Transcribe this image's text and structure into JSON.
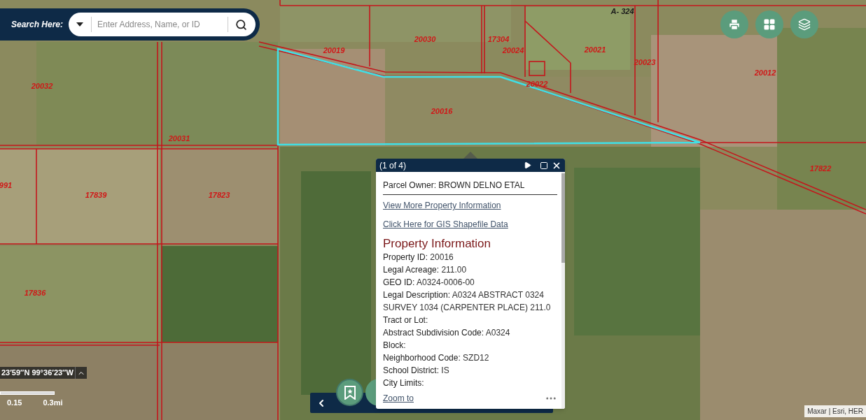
{
  "search": {
    "label": "Search Here:",
    "placeholder": "Enter Address, Name, or ID"
  },
  "map_labels": [
    {
      "kind": "abstract",
      "text": "A- 324"
    },
    {
      "kind": "parcel",
      "text": "20019"
    },
    {
      "kind": "parcel",
      "text": "20030"
    },
    {
      "kind": "parcel",
      "text": "17304"
    },
    {
      "kind": "parcel",
      "text": "20024"
    },
    {
      "kind": "parcel",
      "text": "20022"
    },
    {
      "kind": "parcel",
      "text": "20021"
    },
    {
      "kind": "parcel",
      "text": "20023"
    },
    {
      "kind": "parcel",
      "text": "20012"
    },
    {
      "kind": "parcel",
      "text": "20032"
    },
    {
      "kind": "parcel",
      "text": "20031"
    },
    {
      "kind": "parcel",
      "text": "20016"
    },
    {
      "kind": "parcel",
      "text": "17839"
    },
    {
      "kind": "parcel",
      "text": "17823"
    },
    {
      "kind": "parcel",
      "text": "17822"
    },
    {
      "kind": "parcel",
      "text": "17836"
    },
    {
      "kind": "parcel",
      "text": "991"
    }
  ],
  "popup": {
    "counter": "(1 of 4)",
    "owner": "Parcel Owner: BROWN DELNO ETAL",
    "links": [
      "View More Property Information",
      "Click Here for GIS Shapefile Data"
    ],
    "section_title": "Property Information",
    "fields": [
      {
        "label": "Property ID:",
        "value": "20016"
      },
      {
        "label": "Legal Acreage:",
        "value": "211.00"
      },
      {
        "label": "GEO ID:",
        "value": "A0324-0006-00"
      },
      {
        "label": "Legal Description:",
        "value": "A0324 ABSTRACT 0324 SURVEY 1034 (CARPENTER PLACE) 211.0"
      },
      {
        "label": "Tract or Lot:"
      },
      {
        "label": "Abstract Subdivision Code:",
        "value": "A0324"
      },
      {
        "label": "Block:"
      },
      {
        "label": "Neighborhood Code:",
        "value": "SZD12"
      },
      {
        "label": "School District:",
        "value": "IS"
      },
      {
        "label": "City Limits:"
      }
    ],
    "footer_link": "Zoom to"
  },
  "coordinates": "23′59″N 99°36′23″W",
  "scale_labels": [
    "0.15",
    "0.3mi"
  ],
  "attribution": "Maxar | Esri, HER"
}
